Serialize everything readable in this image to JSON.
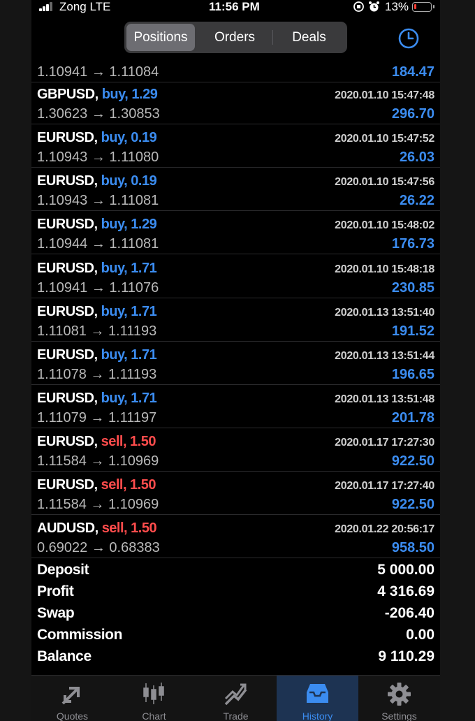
{
  "status_bar": {
    "carrier": "Zong  LTE",
    "time": "11:56 PM",
    "battery_percent": "13%",
    "battery_level": 0.13
  },
  "segments": {
    "items": [
      "Positions",
      "Orders",
      "Deals"
    ],
    "active": "Positions"
  },
  "colors": {
    "buy": "#3b8cf0",
    "sell": "#ff4c4c",
    "profit": "#3b8cf0",
    "accent": "#3b8cf0"
  },
  "positions": [
    {
      "symbol": "",
      "direction": "",
      "type": "",
      "volume": "",
      "time": "",
      "open_price": "1.10941",
      "close_price": "1.11084",
      "profit": "184.47"
    },
    {
      "symbol": "GBPUSD",
      "direction": "buy, 1.29",
      "type": "buy",
      "time": "2020.01.10 15:47:48",
      "open_price": "1.30623",
      "close_price": "1.30853",
      "profit": "296.70"
    },
    {
      "symbol": "EURUSD",
      "direction": "buy, 0.19",
      "type": "buy",
      "time": "2020.01.10 15:47:52",
      "open_price": "1.10943",
      "close_price": "1.11080",
      "profit": "26.03"
    },
    {
      "symbol": "EURUSD",
      "direction": "buy, 0.19",
      "type": "buy",
      "time": "2020.01.10 15:47:56",
      "open_price": "1.10943",
      "close_price": "1.11081",
      "profit": "26.22"
    },
    {
      "symbol": "EURUSD",
      "direction": "buy, 1.29",
      "type": "buy",
      "time": "2020.01.10 15:48:02",
      "open_price": "1.10944",
      "close_price": "1.11081",
      "profit": "176.73"
    },
    {
      "symbol": "EURUSD",
      "direction": "buy, 1.71",
      "type": "buy",
      "time": "2020.01.10 15:48:18",
      "open_price": "1.10941",
      "close_price": "1.11076",
      "profit": "230.85"
    },
    {
      "symbol": "EURUSD",
      "direction": "buy, 1.71",
      "type": "buy",
      "time": "2020.01.13 13:51:40",
      "open_price": "1.11081",
      "close_price": "1.11193",
      "profit": "191.52"
    },
    {
      "symbol": "EURUSD",
      "direction": "buy, 1.71",
      "type": "buy",
      "time": "2020.01.13 13:51:44",
      "open_price": "1.11078",
      "close_price": "1.11193",
      "profit": "196.65"
    },
    {
      "symbol": "EURUSD",
      "direction": "buy, 1.71",
      "type": "buy",
      "time": "2020.01.13 13:51:48",
      "open_price": "1.11079",
      "close_price": "1.11197",
      "profit": "201.78"
    },
    {
      "symbol": "EURUSD",
      "direction": "sell, 1.50",
      "type": "sell",
      "time": "2020.01.17 17:27:30",
      "open_price": "1.11584",
      "close_price": "1.10969",
      "profit": "922.50"
    },
    {
      "symbol": "EURUSD",
      "direction": "sell, 1.50",
      "type": "sell",
      "time": "2020.01.17 17:27:40",
      "open_price": "1.11584",
      "close_price": "1.10969",
      "profit": "922.50"
    },
    {
      "symbol": "AUDUSD",
      "direction": "sell, 1.50",
      "type": "sell",
      "time": "2020.01.22 20:56:17",
      "open_price": "0.69022",
      "close_price": "0.68383",
      "profit": "958.50"
    }
  ],
  "summary": [
    {
      "label": "Deposit",
      "value": "5 000.00"
    },
    {
      "label": "Profit",
      "value": "4 316.69"
    },
    {
      "label": "Swap",
      "value": "-206.40"
    },
    {
      "label": "Commission",
      "value": "0.00"
    },
    {
      "label": "Balance",
      "value": "9 110.29"
    }
  ],
  "tabbar": {
    "items": [
      {
        "label": "Quotes",
        "icon": "quotes-icon"
      },
      {
        "label": "Chart",
        "icon": "candlestick-icon"
      },
      {
        "label": "Trade",
        "icon": "trade-icon"
      },
      {
        "label": "History",
        "icon": "inbox-icon"
      },
      {
        "label": "Settings",
        "icon": "gear-icon"
      }
    ],
    "active": "History"
  }
}
